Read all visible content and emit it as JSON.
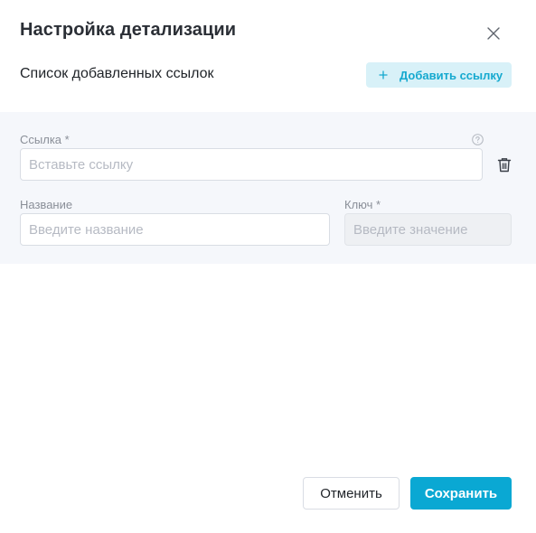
{
  "dialog": {
    "title": "Настройка детализации",
    "subtitle": "Список добавленных ссылок",
    "add_link_label": "Добавить ссылку"
  },
  "form": {
    "link_label": "Ссылка",
    "link_required": "*",
    "link_placeholder": "Вставьте ссылку",
    "name_label": "Название",
    "name_placeholder": "Введите название",
    "key_label": "Ключ",
    "key_required": "*",
    "key_placeholder": "Введите значение"
  },
  "footer": {
    "cancel_label": "Отменить",
    "save_label": "Сохранить"
  },
  "colors": {
    "accent": "#0aa8d3",
    "accent_light": "#d8f1f8",
    "panel_bg": "#f5f7fb"
  },
  "icons": [
    "close-icon",
    "plus-icon",
    "help-icon",
    "trash-icon"
  ]
}
